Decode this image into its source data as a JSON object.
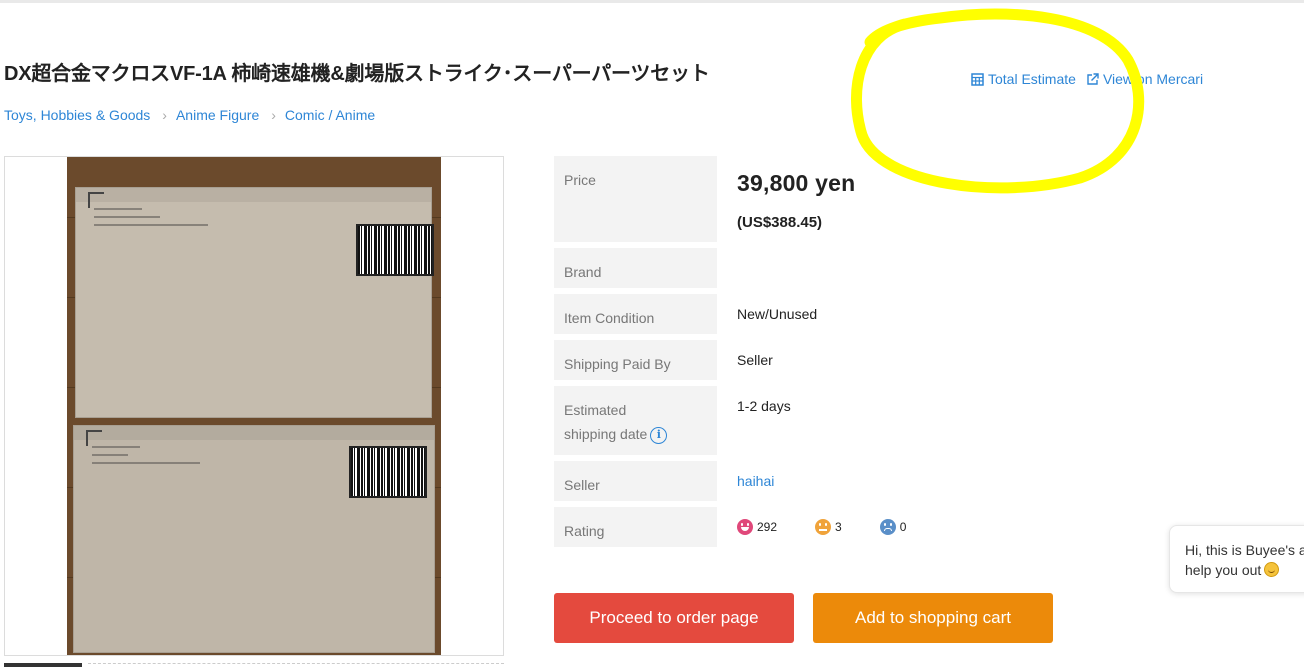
{
  "product": {
    "title": "DX超合金マクロスVF-1A 柿崎速雄機&劇場版ストライク･スーパーパーツセット"
  },
  "top_links": {
    "total_estimate": "Total Estimate",
    "view_on_mercari": "View on Mercari"
  },
  "breadcrumb": [
    "Toys, Hobbies & Goods",
    "Anime Figure",
    "Comic / Anime"
  ],
  "specs": {
    "price_label": "Price",
    "price_value": "39,800 yen",
    "price_usd": "(US$388.45)",
    "brand_label": "Brand",
    "brand_value": "",
    "condition_label": "Item Condition",
    "condition_value": "New/Unused",
    "shipping_paid_label": "Shipping Paid By",
    "shipping_paid_value": "Seller",
    "est_shipping_label": "Estimated shipping date",
    "est_shipping_value": "1-2 days",
    "seller_label": "Seller",
    "seller_value": "haihai",
    "rating_label": "Rating"
  },
  "ratings": {
    "good": "292",
    "neutral": "3",
    "bad": "0"
  },
  "buttons": {
    "order": "Proceed to order page",
    "cart": "Add to shopping cart"
  },
  "chat": {
    "line1": "Hi, this is Buyee's a",
    "line2": "help you out"
  },
  "colors": {
    "link": "#2e86d6",
    "order_button": "#e44a3e",
    "cart_button": "#ec8a0a",
    "annotation": "#ffff00"
  },
  "icons": [
    "calculator-icon",
    "external-link-icon",
    "chevron-right-icon",
    "info-icon",
    "smile-face-icon",
    "neutral-face-icon",
    "sad-face-icon",
    "smile-emoji-icon"
  ]
}
